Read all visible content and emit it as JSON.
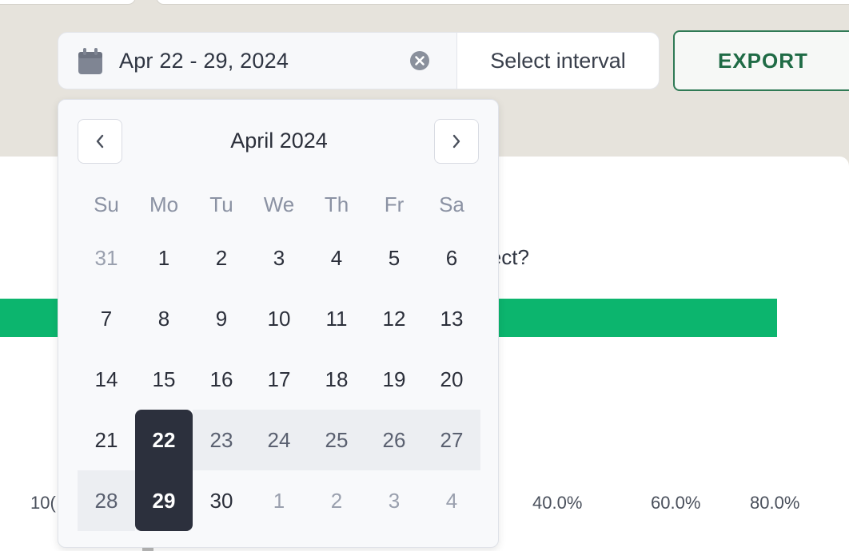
{
  "toolbar": {
    "date_range_value": "Apr 22 - 29, 2024",
    "select_interval_label": "Select interval",
    "export_label": "EXPORT"
  },
  "icons": {
    "calendar": "calendar-icon",
    "clear": "clear-circle-icon",
    "prev": "chevron-left-icon",
    "next": "chevron-right-icon"
  },
  "calendar": {
    "month_title": "April 2024",
    "weekdays": [
      "Su",
      "Mo",
      "Tu",
      "We",
      "Th",
      "Fr",
      "Sa"
    ],
    "weeks": [
      [
        "31",
        "1",
        "2",
        "3",
        "4",
        "5",
        "6"
      ],
      [
        "7",
        "8",
        "9",
        "10",
        "11",
        "12",
        "13"
      ],
      [
        "14",
        "15",
        "16",
        "17",
        "18",
        "19",
        "20"
      ],
      [
        "21",
        "22",
        "23",
        "24",
        "25",
        "26",
        "27"
      ],
      [
        "28",
        "29",
        "30",
        "1",
        "2",
        "3",
        "4"
      ]
    ],
    "selected_start": "22",
    "selected_end": "29"
  },
  "background": {
    "question_fragment": "lect?",
    "axis_ticks": [
      "10(",
      "40.0%",
      "60.0%",
      "80.0%"
    ]
  },
  "colors": {
    "accent_green": "#0cb56e",
    "export_green": "#1f6b45",
    "selected_dark": "#2c303d"
  }
}
